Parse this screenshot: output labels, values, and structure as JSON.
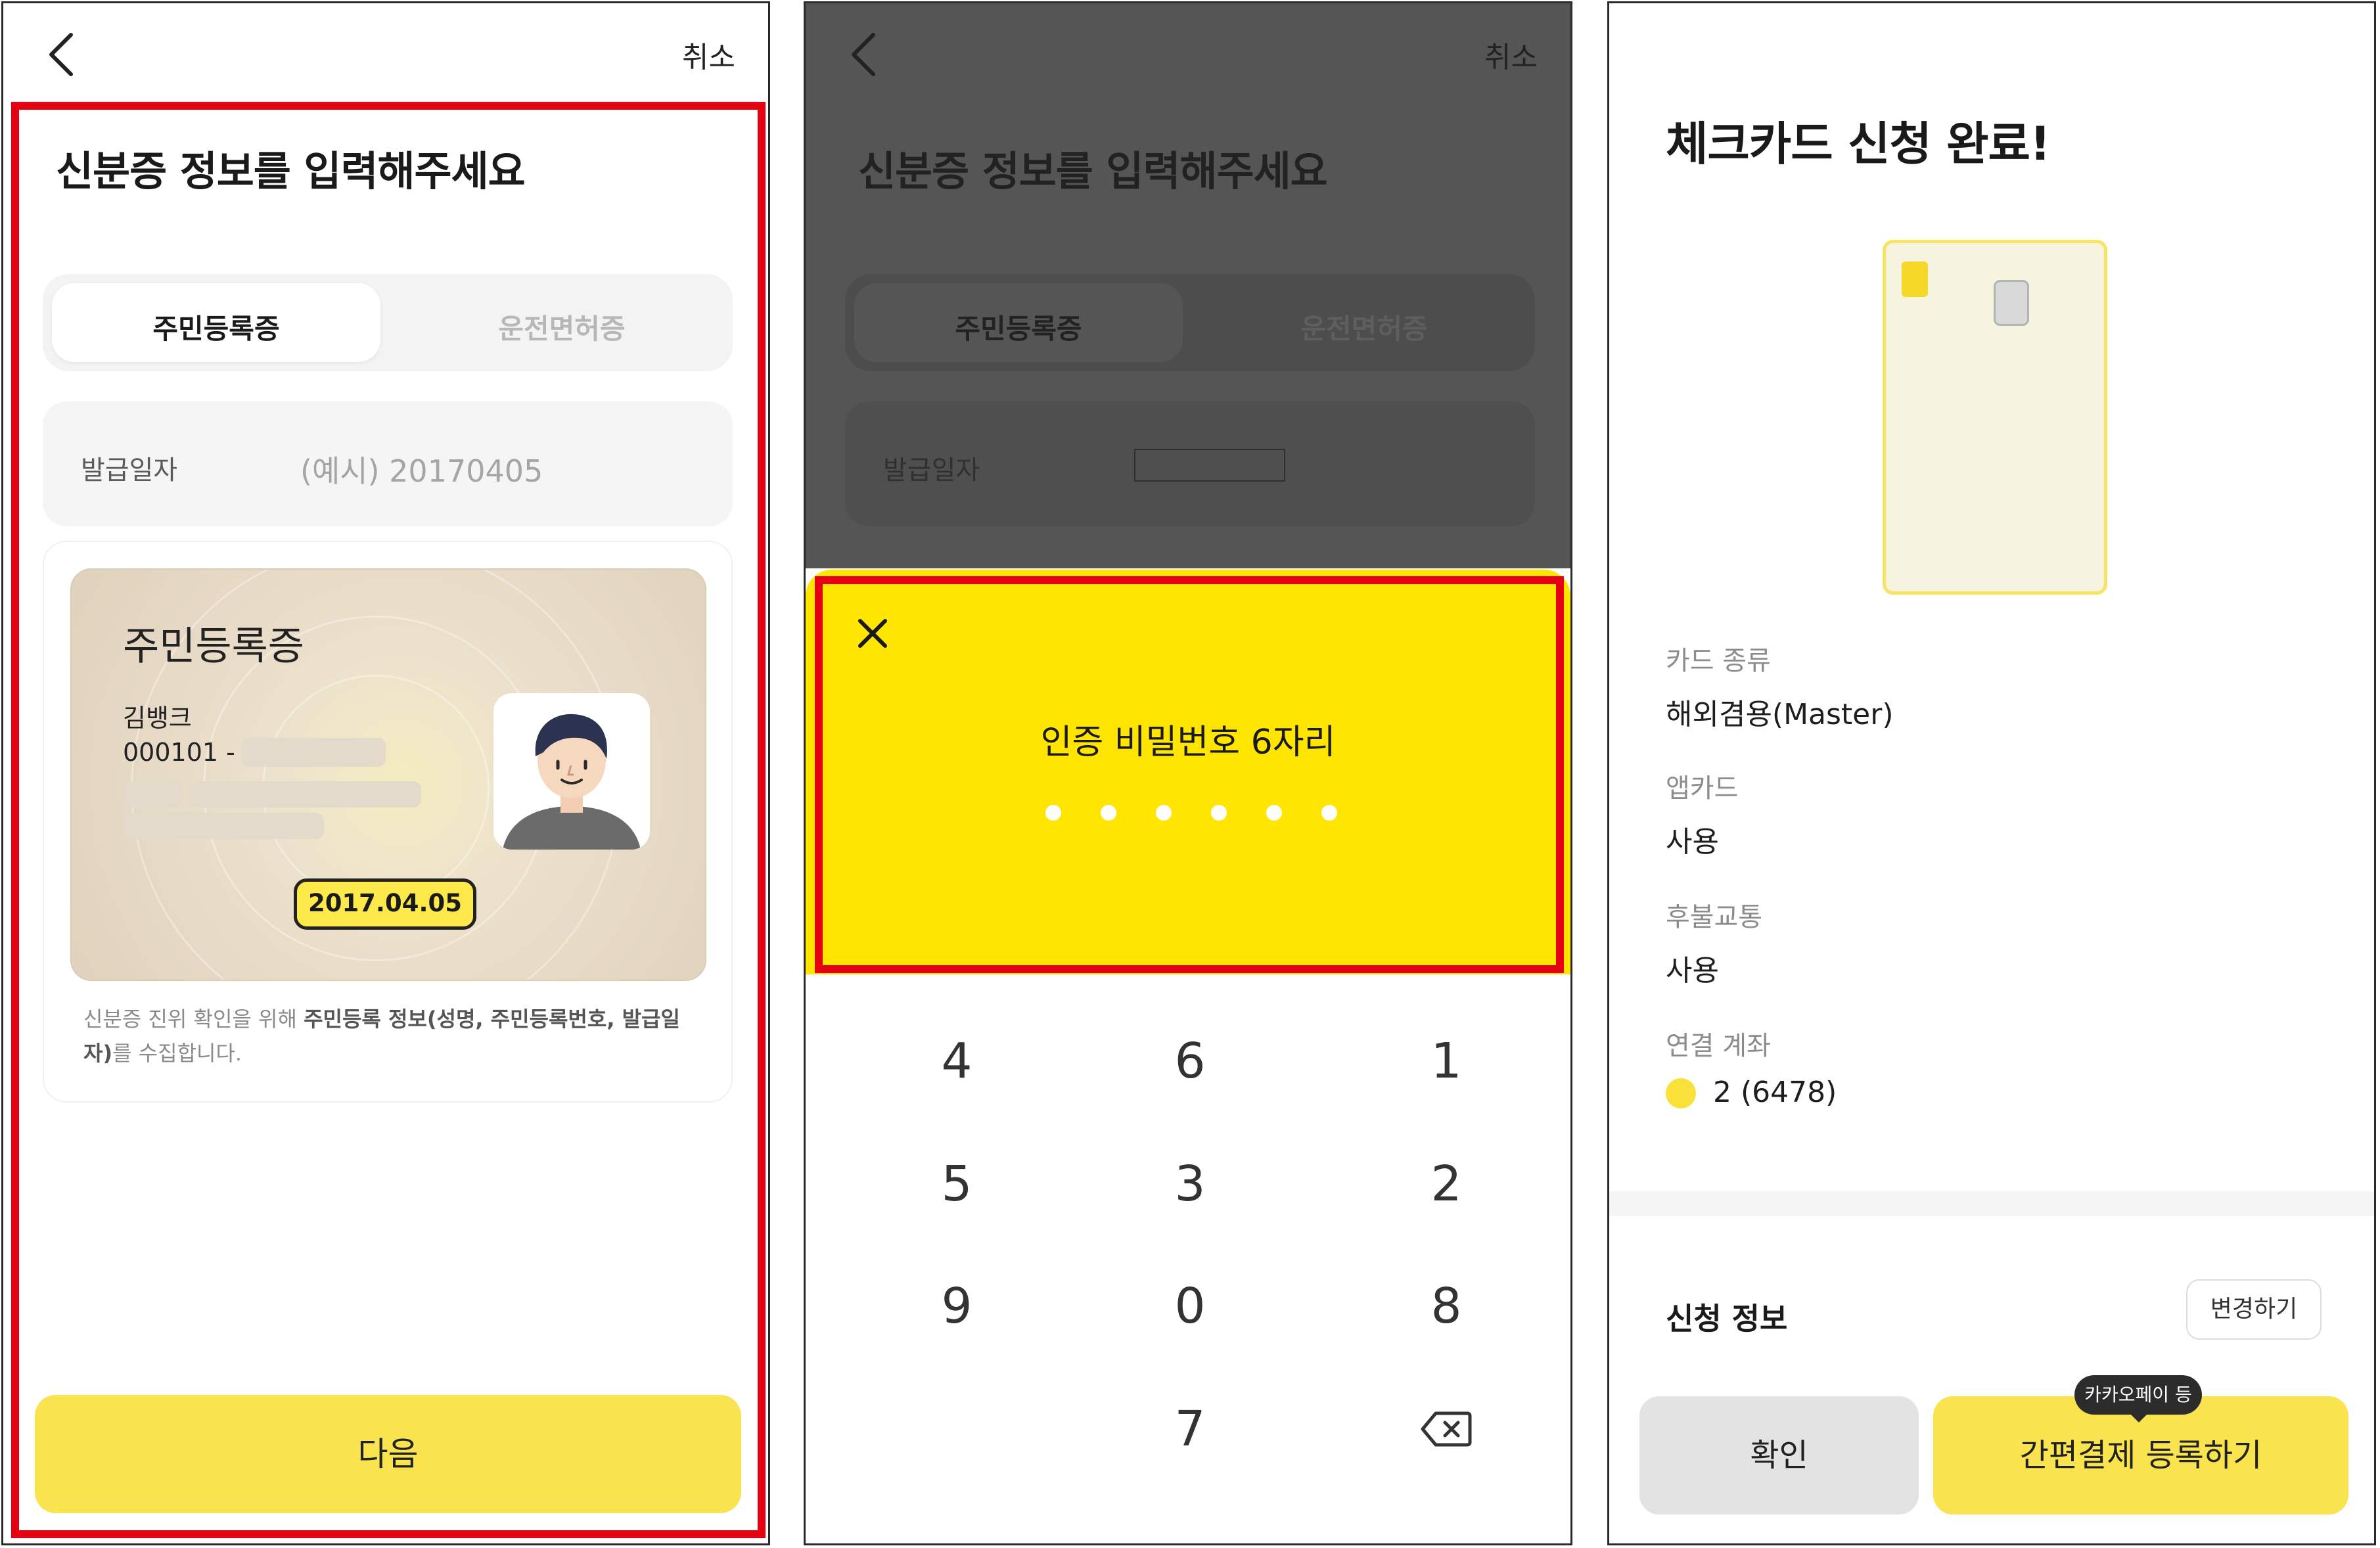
{
  "panel1": {
    "cancel": "취소",
    "title": "신분증 정보를 입력해주세요",
    "tabs": [
      {
        "label": "주민등록증"
      },
      {
        "label": "운전면허증"
      }
    ],
    "date_field": {
      "label": "발급일자",
      "placeholder": "(예시) 20170405"
    },
    "id_card": {
      "title": "주민등록증",
      "name": "김뱅크",
      "number_prefix": "000101 -",
      "issue_date": "2017.04.05"
    },
    "note": {
      "part1": "신분증 진위 확인을 위해 ",
      "part2": "주민등록 정보(성명, 주민등록번호, 발급일자)",
      "part3": "를 수집합니다."
    },
    "next_button": "다음"
  },
  "panel2": {
    "cancel": "취소",
    "title": "신분증 정보를 입력해주세요",
    "tabs": [
      {
        "label": "주민등록증"
      },
      {
        "label": "운전면허증"
      }
    ],
    "date_label": "발급일자",
    "pin_title": "인증 비밀번호 6자리",
    "pin_length": 6,
    "keypad": [
      "4",
      "6",
      "1",
      "5",
      "3",
      "2",
      "9",
      "0",
      "8",
      "7"
    ]
  },
  "panel3": {
    "title": "체크카드 신청 완료!",
    "info": [
      {
        "label": "카드 종류",
        "value": "해외겸용(Master)"
      },
      {
        "label": "앱카드",
        "value": "사용"
      },
      {
        "label": "후불교통",
        "value": "사용"
      },
      {
        "label": "연결 계좌",
        "value": "2 (6478)"
      }
    ],
    "section_title": "신청 정보",
    "change_button": "변경하기",
    "confirm_button": "확인",
    "pay_button": "간편결제 등록하기",
    "tooltip": "카카오페이 등"
  },
  "colors": {
    "accent_yellow": "#f9e34f",
    "sheet_yellow": "#ffe500",
    "highlight_red": "#e50012",
    "dim_overlay": "#555555"
  }
}
